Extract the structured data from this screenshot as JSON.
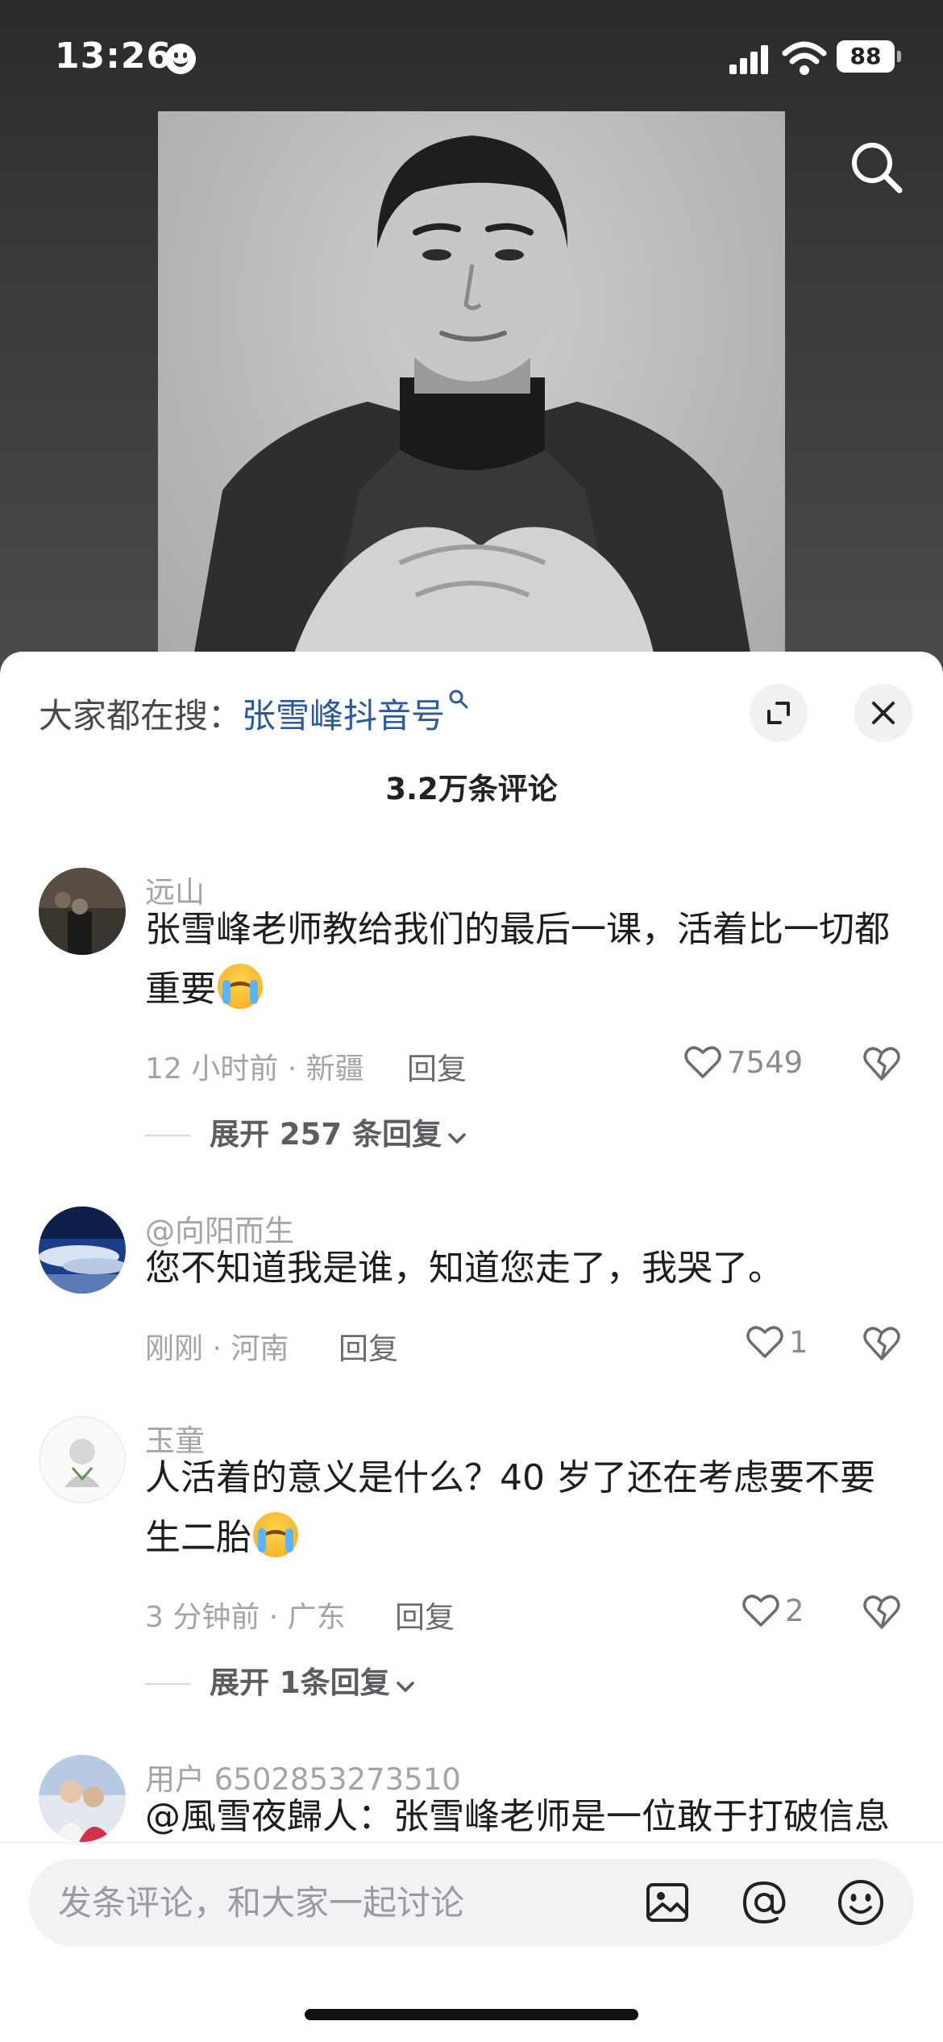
{
  "status_bar": {
    "time": "13:26",
    "battery": "88"
  },
  "video": {
    "search_icon": "search-icon"
  },
  "sheet": {
    "hot_search_prefix": "大家都在搜：",
    "hot_search_keyword": "张雪峰抖音号",
    "comment_count": "3.2万条评论",
    "expand_icon": "expand-icon",
    "close_icon": "close-icon"
  },
  "comments": [
    {
      "username": "远山",
      "text": "张雪峰老师教给我们的最后一课，活着比一切都重要",
      "emoji": "loudly-crying-face",
      "time_location": "12 小时前 · 新疆",
      "reply_label": "回复",
      "likes": "7549",
      "expand_replies": "展开 257 条回复"
    },
    {
      "username": "@向阳而生",
      "text": "您不知道我是谁，知道您走了，我哭了。",
      "time_location": "刚刚 · 河南",
      "reply_label": "回复",
      "likes": "1"
    },
    {
      "username": "玉童",
      "text": "人活着的意义是什么？40 岁了还在考虑要不要生二胎",
      "emoji": "loudly-crying-face",
      "time_location": "3 分钟前 · 广东",
      "reply_label": "回复",
      "likes": "2",
      "expand_replies": "展开 1条回复"
    },
    {
      "username": "用户 6502853273510",
      "text": "@風雪夜歸人：张雪峰老师是一位敢于打破信息"
    }
  ],
  "input": {
    "placeholder": "发条评论，和大家一起讨论",
    "icons": [
      "image-icon",
      "at-icon",
      "emoji-icon"
    ]
  },
  "colors": {
    "keyword_blue": "#2b5a9c",
    "sheet_bg": "#ffffff",
    "muted_text": "#a3a3a8"
  }
}
